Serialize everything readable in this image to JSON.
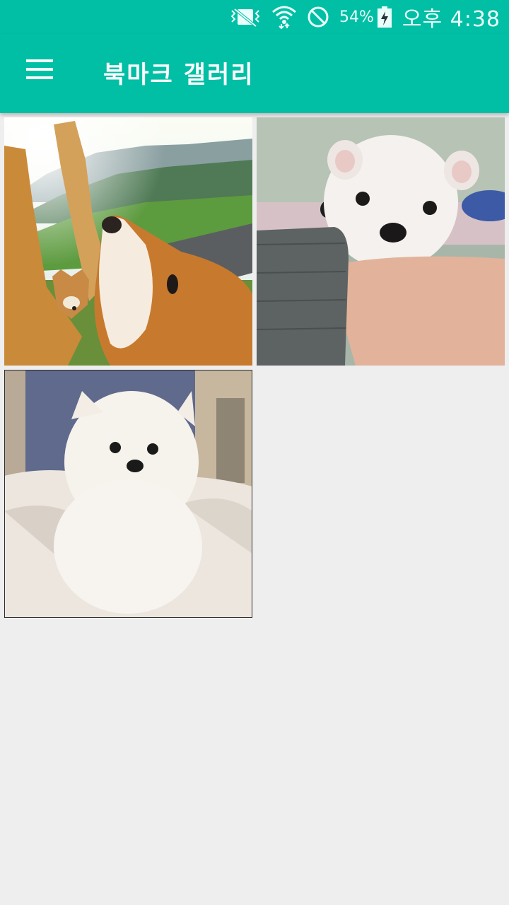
{
  "status_bar": {
    "icons": [
      "vibrate-icon",
      "wifi-icon",
      "do-not-disturb-icon",
      "battery-charging-icon"
    ],
    "battery_percent": "54%",
    "time": "오후 4:38"
  },
  "app_bar": {
    "menu_icon": "menu-icon",
    "title": "북마크 갤러리"
  },
  "gallery": {
    "photos": [
      {
        "subject": "shiba-dogs-raising-paws"
      },
      {
        "subject": "white-puppy-on-arm"
      },
      {
        "subject": "white-pomeranian-on-bed"
      }
    ]
  },
  "colors": {
    "primary": "#00bfa5",
    "background": "#eeeeee"
  }
}
